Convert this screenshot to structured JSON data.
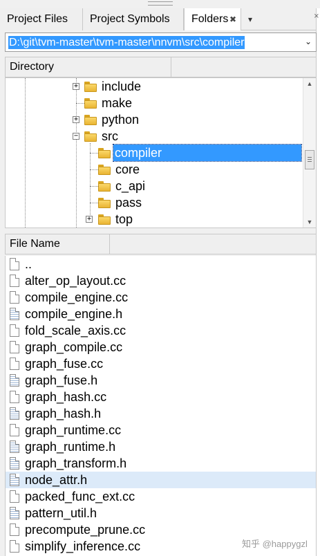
{
  "tabs": [
    {
      "label": "Project Files",
      "active": false
    },
    {
      "label": "Project Symbols",
      "active": false
    },
    {
      "label": "Folders",
      "active": true
    }
  ],
  "tab_close_glyph": "✖",
  "tab_menu_glyph": "▾",
  "pin_glyph": "⨯",
  "path": {
    "value": "D:\\git\\tvm-master\\tvm-master\\nnvm\\src\\compiler",
    "dropdown_glyph": "⌄"
  },
  "directory": {
    "header": "Directory",
    "items": [
      {
        "label": "include",
        "expander": "+",
        "selected": false
      },
      {
        "label": "make",
        "expander": "",
        "selected": false
      },
      {
        "label": "python",
        "expander": "+",
        "selected": false
      },
      {
        "label": "src",
        "expander": "−",
        "selected": false
      },
      {
        "label": "compiler",
        "expander": "",
        "selected": true
      },
      {
        "label": "core",
        "expander": "",
        "selected": false
      },
      {
        "label": "c_api",
        "expander": "",
        "selected": false
      },
      {
        "label": "pass",
        "expander": "",
        "selected": false
      },
      {
        "label": "top",
        "expander": "+",
        "selected": false
      }
    ],
    "scroll_up_glyph": "▲",
    "scroll_down_glyph": "▼"
  },
  "files": {
    "header": "File Name",
    "items": [
      {
        "name": "..",
        "icon": "file-icon"
      },
      {
        "name": "alter_op_layout.cc",
        "icon": "file-icon"
      },
      {
        "name": "compile_engine.cc",
        "icon": "file-icon"
      },
      {
        "name": "compile_engine.h",
        "icon": "header-file-icon"
      },
      {
        "name": "fold_scale_axis.cc",
        "icon": "file-icon"
      },
      {
        "name": "graph_compile.cc",
        "icon": "file-icon"
      },
      {
        "name": "graph_fuse.cc",
        "icon": "file-icon"
      },
      {
        "name": "graph_fuse.h",
        "icon": "header-file-icon"
      },
      {
        "name": "graph_hash.cc",
        "icon": "file-icon"
      },
      {
        "name": "graph_hash.h",
        "icon": "header-file-icon"
      },
      {
        "name": "graph_runtime.cc",
        "icon": "file-icon"
      },
      {
        "name": "graph_runtime.h",
        "icon": "header-file-icon"
      },
      {
        "name": "graph_transform.h",
        "icon": "header-file-icon"
      },
      {
        "name": "node_attr.h",
        "icon": "header-file-icon"
      },
      {
        "name": "packed_func_ext.cc",
        "icon": "file-icon"
      },
      {
        "name": "pattern_util.h",
        "icon": "header-file-icon"
      },
      {
        "name": "precompute_prune.cc",
        "icon": "file-icon"
      },
      {
        "name": "simplify_inference.cc",
        "icon": "file-icon"
      }
    ]
  },
  "watermark": "知乎 @happygzl",
  "colors": {
    "selection": "#3399ff",
    "hover_row": "#dceaf9",
    "folder": "#f3c547"
  }
}
